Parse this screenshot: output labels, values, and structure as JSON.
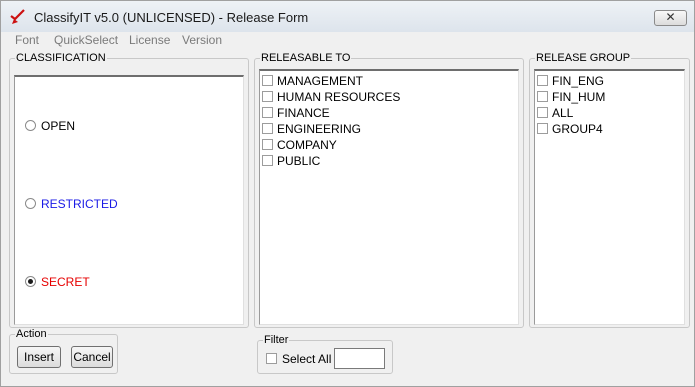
{
  "window": {
    "title": "ClassifyIT v5.0 (UNLICENSED) - Release Form",
    "close_glyph": "✕"
  },
  "menu": [
    "Font",
    "QuickSelect",
    "License",
    "Version"
  ],
  "classification": {
    "title": "CLASSIFICATION",
    "options": [
      {
        "label": "OPEN",
        "color": "#000000",
        "checked": false
      },
      {
        "label": "RESTRICTED",
        "color": "#1a1ae6",
        "checked": false
      },
      {
        "label": "SECRET",
        "color": "#e60000",
        "checked": true
      }
    ]
  },
  "releasable_to": {
    "title": "RELEASABLE TO",
    "items": [
      "MANAGEMENT",
      "HUMAN RESOURCES",
      "FINANCE",
      "ENGINEERING",
      "COMPANY",
      "PUBLIC"
    ]
  },
  "release_group": {
    "title": "RELEASE GROUP",
    "items": [
      "FIN_ENG",
      "FIN_HUM",
      "ALL",
      "GROUP4"
    ]
  },
  "action": {
    "title": "Action",
    "insert_label": "Insert",
    "cancel_label": "Cancel"
  },
  "filter": {
    "title": "Filter",
    "select_all_label": "Select All",
    "value": ""
  }
}
